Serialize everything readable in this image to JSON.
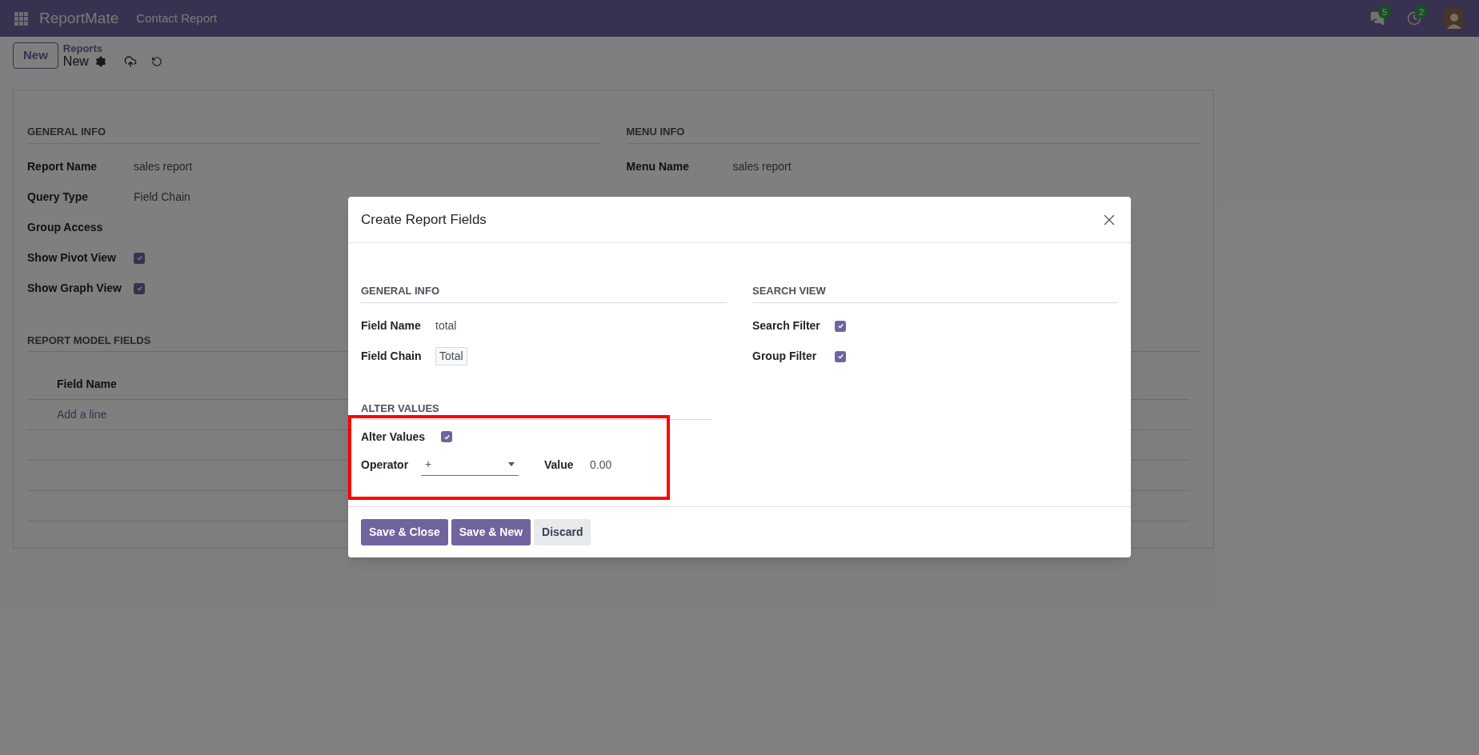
{
  "navbar": {
    "app_name": "ReportMate",
    "menu": [
      "Contact Report"
    ],
    "indicators": [
      {
        "kind": "chat",
        "count": "5"
      },
      {
        "kind": "activity",
        "count": "2"
      }
    ]
  },
  "control_panel": {
    "new_button": "New",
    "breadcrumb": "Reports",
    "record": "New"
  },
  "form": {
    "columns": [
      {
        "title": "GENERAL INFO",
        "fields": [
          {
            "kind": "text",
            "label": "Report Name",
            "value": "sales report"
          },
          {
            "kind": "text",
            "label": "Query Type",
            "value": "Field Chain"
          },
          {
            "kind": "text",
            "label": "Group Access"
          },
          {
            "kind": "checkbox",
            "label": "Show Pivot View",
            "checked": true
          },
          {
            "kind": "checkbox",
            "label": "Show Graph View",
            "checked": true
          }
        ]
      },
      {
        "title": "MENU INFO",
        "fields": [
          {
            "kind": "text",
            "label": "Menu Name",
            "value": "sales report"
          }
        ]
      }
    ],
    "model_fields": {
      "title": "REPORT MODEL FIELDS",
      "columns": [
        "Field Name"
      ],
      "add_line": "Add a line"
    }
  },
  "dialog": {
    "title": "Create Report Fields",
    "general": {
      "title": "GENERAL INFO",
      "field_name_label": "Field Name",
      "field_name": "total",
      "field_chain_label": "Field Chain",
      "field_chain": "Total"
    },
    "search_view": {
      "title": "SEARCH VIEW",
      "fields": [
        {
          "label": "Search Filter",
          "checked": true
        },
        {
          "label": "Group Filter",
          "checked": true
        }
      ]
    },
    "alter": {
      "title": "ALTER VALUES",
      "checkbox_label": "Alter Values",
      "checked": true,
      "operator_label": "Operator",
      "operator": "+",
      "value_label": "Value",
      "value": "0.00"
    },
    "buttons": [
      {
        "label": "Save & Close",
        "kind": "primary"
      },
      {
        "label": "Save & New",
        "kind": "primary"
      },
      {
        "label": "Discard",
        "kind": "secondary"
      }
    ]
  }
}
